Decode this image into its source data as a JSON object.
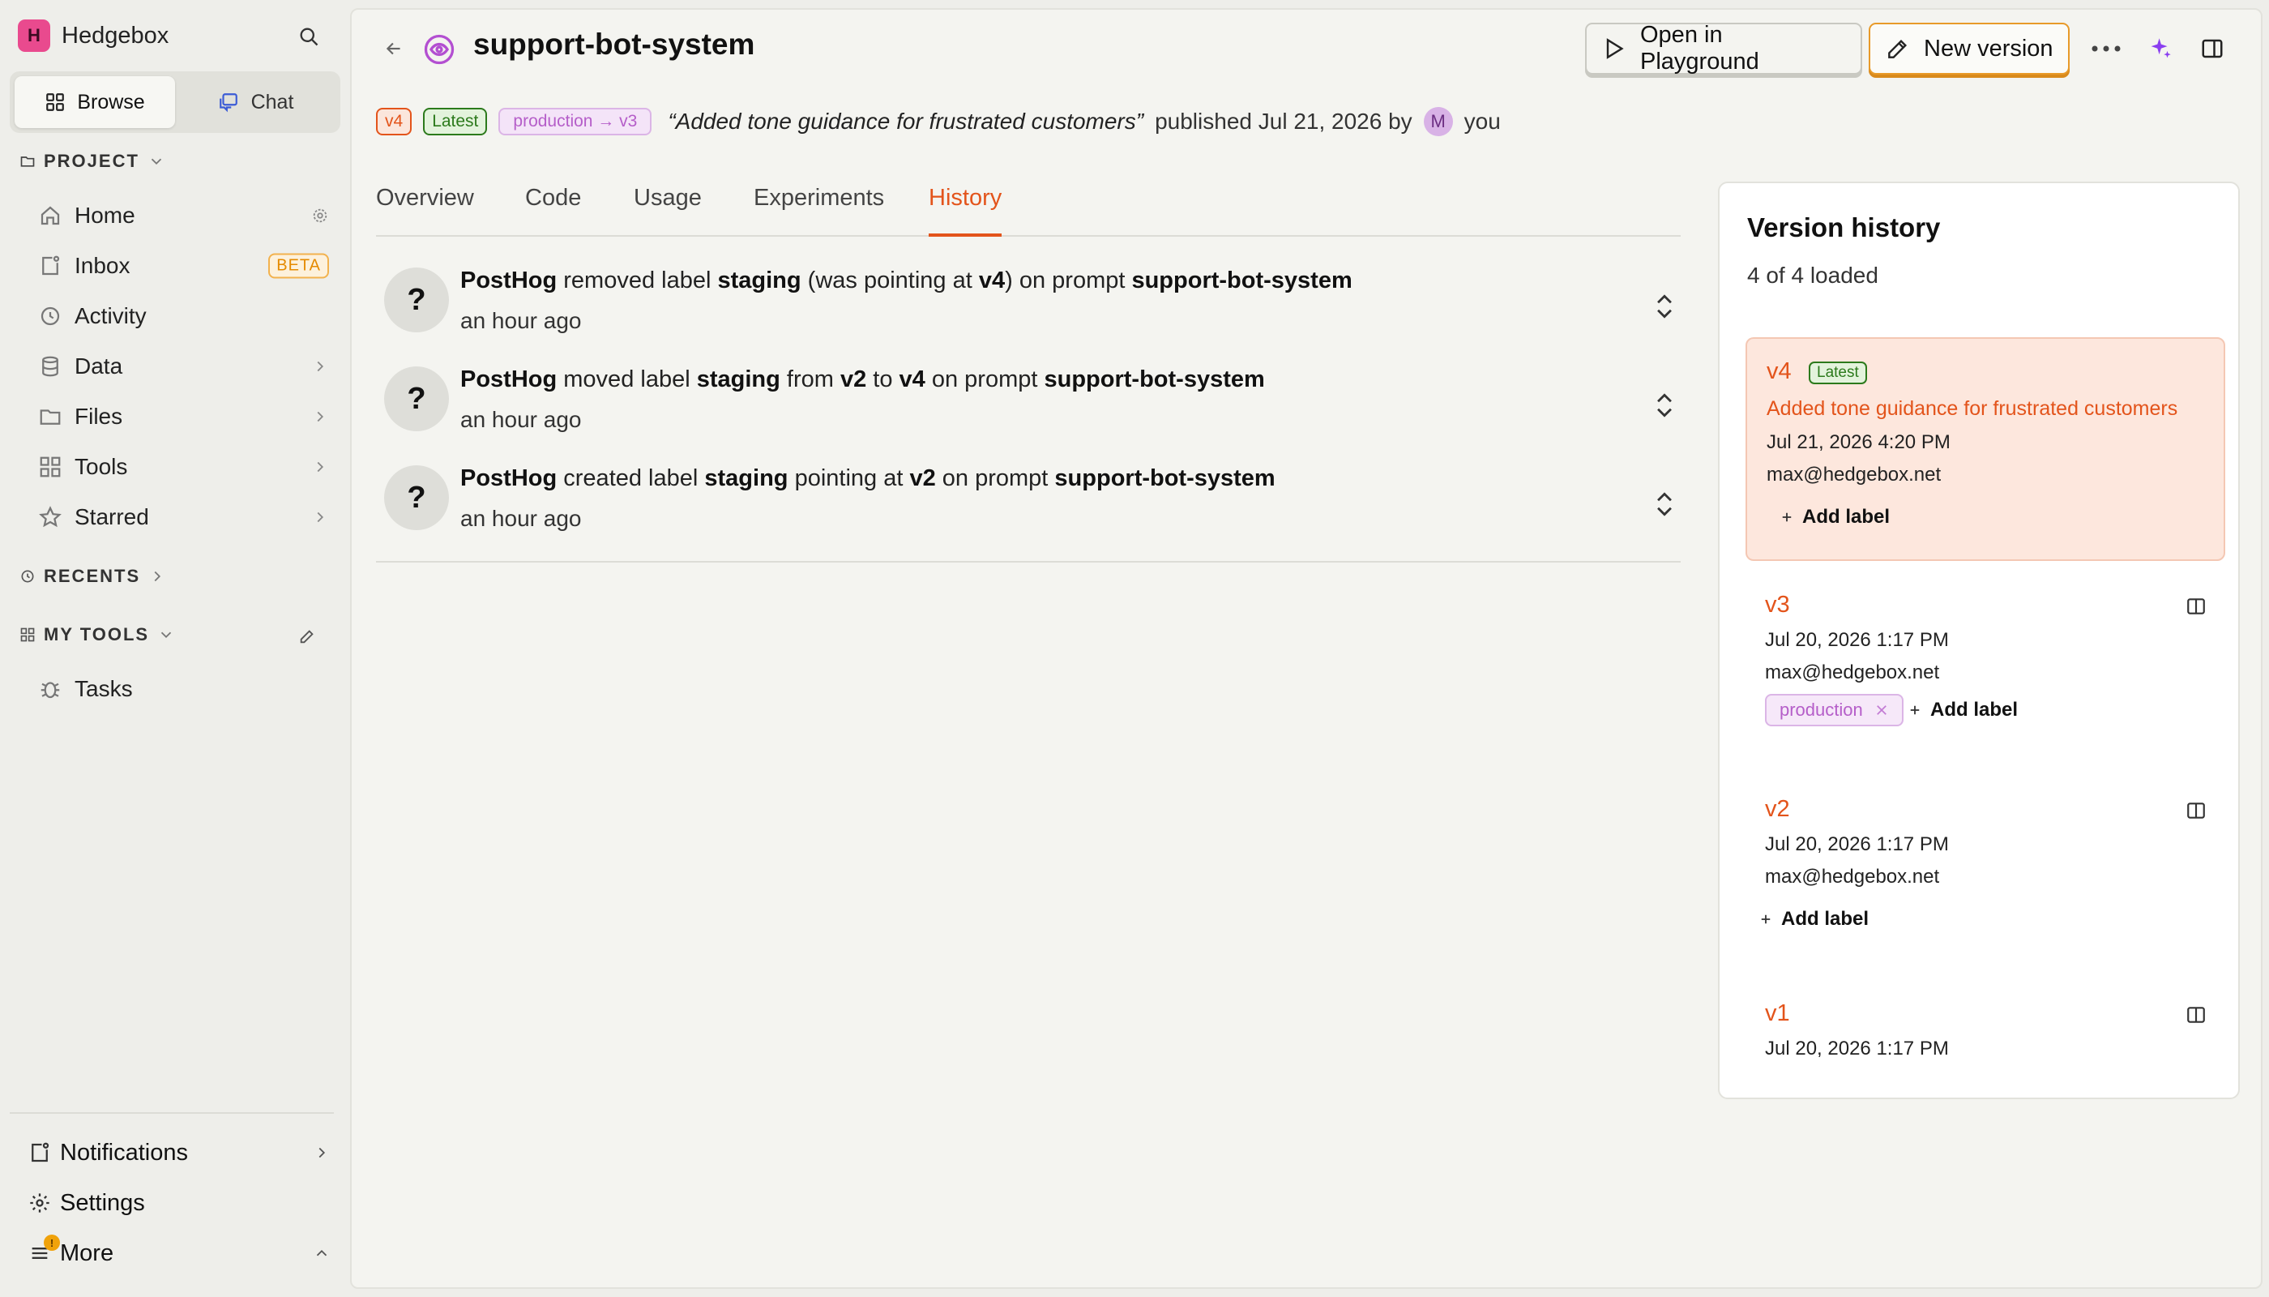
{
  "sidebar": {
    "org": {
      "initial": "H",
      "name": "Hedgebox"
    },
    "switch": {
      "browse": "Browse",
      "chat": "Chat"
    },
    "project_label": "PROJECT",
    "items": [
      {
        "label": "Home",
        "icon": "home-icon"
      },
      {
        "label": "Inbox",
        "icon": "inbox-icon",
        "badge": "BETA"
      },
      {
        "label": "Activity",
        "icon": "clock-icon"
      },
      {
        "label": "Data",
        "icon": "database-icon"
      },
      {
        "label": "Files",
        "icon": "folder-icon"
      },
      {
        "label": "Tools",
        "icon": "grid-icon"
      },
      {
        "label": "Starred",
        "icon": "star-icon"
      }
    ],
    "recents_label": "RECENTS",
    "mytools_label": "MY TOOLS",
    "tasks_label": "Tasks",
    "notifications_label": "Notifications",
    "settings_label": "Settings",
    "more_label": "More",
    "more_badge": "!"
  },
  "header": {
    "title": "support-bot-system",
    "open_playground": "Open in Playground",
    "new_version": "New version"
  },
  "meta": {
    "version_tag": "v4",
    "latest_tag": "Latest",
    "label_tag": "production → v3",
    "message": "“Added tone guidance for frustrated customers”",
    "published": "published Jul 21, 2026 by",
    "avatar_initial": "M",
    "author": "you"
  },
  "tabs": [
    "Overview",
    "Code",
    "Usage",
    "Experiments",
    "History"
  ],
  "active_tab": "History",
  "history": [
    {
      "actor": "PostHog",
      "parts": [
        " removed label ",
        "staging",
        " (was pointing at ",
        "v4",
        ") on prompt ",
        "support-bot-system"
      ],
      "time": "an hour ago"
    },
    {
      "actor": "PostHog",
      "parts": [
        " moved label ",
        "staging",
        " from ",
        "v2",
        " to ",
        "v4",
        " on prompt ",
        "support-bot-system"
      ],
      "time": "an hour ago"
    },
    {
      "actor": "PostHog",
      "parts": [
        " created label ",
        "staging",
        " pointing at ",
        "v2",
        " on prompt ",
        "support-bot-system"
      ],
      "time": "an hour ago"
    }
  ],
  "version_history": {
    "title": "Version history",
    "count": "4 of 4 loaded",
    "add_label": "Add label",
    "versions": [
      {
        "name": "v4",
        "latest": "Latest",
        "message": "Added tone guidance for frustrated customers",
        "date": "Jul 21, 2026 4:20 PM",
        "author": "max@hedgebox.net"
      },
      {
        "name": "v3",
        "date": "Jul 20, 2026 1:17 PM",
        "author": "max@hedgebox.net",
        "label": "production"
      },
      {
        "name": "v2",
        "date": "Jul 20, 2026 1:17 PM",
        "author": "max@hedgebox.net"
      },
      {
        "name": "v1",
        "date": "Jul 20, 2026 1:17 PM"
      }
    ]
  },
  "colors": {
    "accent": "#e3541b",
    "latest": "#2c7a1c",
    "label": "#b55ec9",
    "primary_border": "#e89a2a"
  }
}
